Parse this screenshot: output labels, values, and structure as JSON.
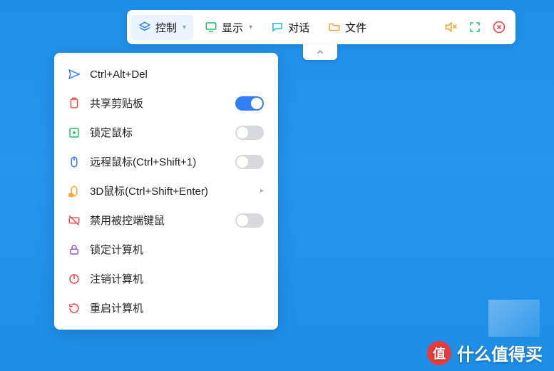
{
  "toolbar": {
    "items": [
      {
        "label": "控制"
      },
      {
        "label": "显示"
      },
      {
        "label": "对话"
      },
      {
        "label": "文件"
      }
    ]
  },
  "menu": {
    "items": [
      {
        "label": "Ctrl+Alt+Del",
        "icon": "send",
        "kind": "action"
      },
      {
        "label": "共享剪贴板",
        "icon": "clipboard",
        "kind": "toggle",
        "on": true
      },
      {
        "label": "锁定鼠标",
        "icon": "target",
        "kind": "toggle",
        "on": false
      },
      {
        "label": "远程鼠标(Ctrl+Shift+1)",
        "icon": "mouse",
        "kind": "toggle",
        "on": false
      },
      {
        "label": "3D鼠标(Ctrl+Shift+Enter)",
        "icon": "mouse3d",
        "kind": "submenu"
      },
      {
        "label": "禁用被控端键鼠",
        "icon": "keyboard-off",
        "kind": "toggle",
        "on": false
      },
      {
        "label": "锁定计算机",
        "icon": "lock",
        "kind": "action"
      },
      {
        "label": "注销计算机",
        "icon": "power",
        "kind": "action"
      },
      {
        "label": "重启计算机",
        "icon": "restart",
        "kind": "action"
      }
    ]
  },
  "watermark": {
    "badge": "值",
    "text": "什么值得买"
  },
  "colors": {
    "accent": "#2f7ef6",
    "green": "#1fbf66",
    "orange": "#f7a537",
    "red": "#ef4c49",
    "purple": "#9a59d6",
    "cyan": "#1dbdd0"
  }
}
